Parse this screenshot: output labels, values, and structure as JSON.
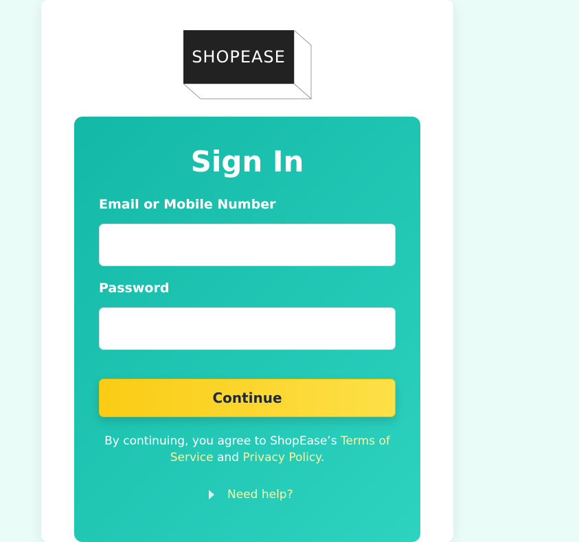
{
  "logo": {
    "text": "SHOPEASE"
  },
  "form": {
    "title": "Sign In",
    "email_label": "Email or Mobile Number",
    "email_value": "",
    "password_label": "Password",
    "password_value": "",
    "continue_label": "Continue"
  },
  "terms": {
    "prefix": "By continuing, you agree to ShopEase’s ",
    "terms_link": "Terms of Service",
    "middle": " and ",
    "privacy_link": "Privacy Policy",
    "suffix": "."
  },
  "help": {
    "label": "Need help?"
  },
  "colors": {
    "background": "#eafcf7",
    "panel_start": "#14b8a6",
    "panel_end": "#2ed3c0",
    "button_start": "#facc15",
    "button_end": "#fde047",
    "link": "#fff59d"
  }
}
